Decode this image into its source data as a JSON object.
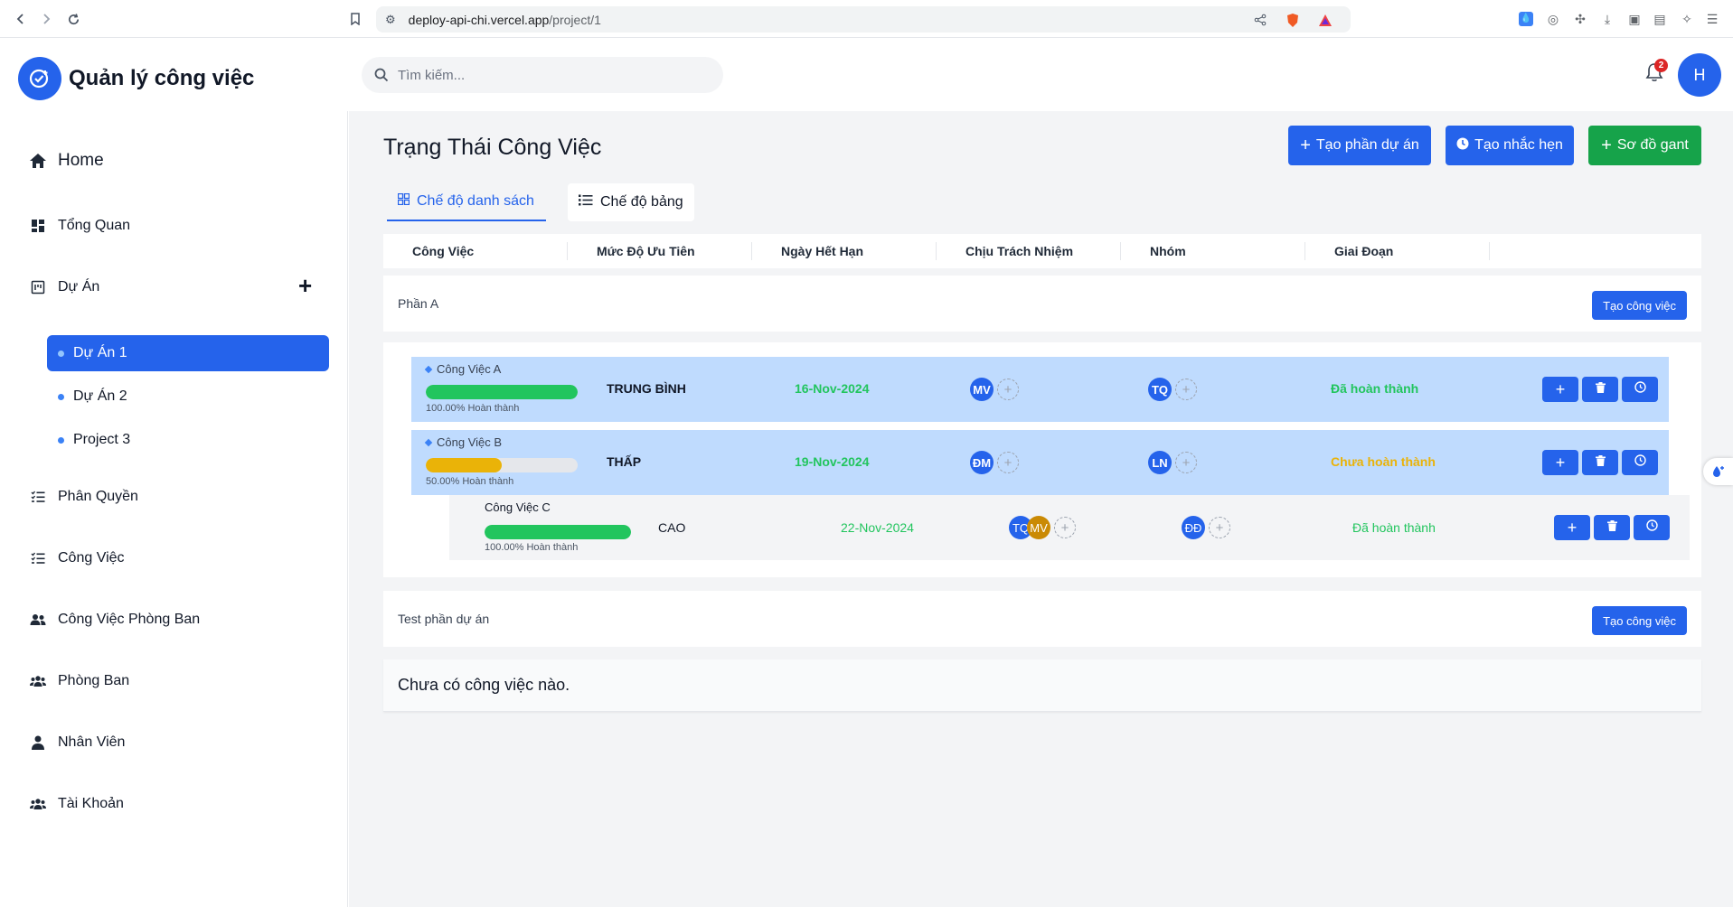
{
  "browser": {
    "url_host": "deploy-api-chi.vercel.app",
    "url_path": "/project/1"
  },
  "header": {
    "app_title": "Quản lý công việc",
    "search_placeholder": "Tìm kiếm...",
    "notification_count": "2",
    "user_initial": "H"
  },
  "sidebar": {
    "home": "Home",
    "items": [
      {
        "label": "Tổng Quan",
        "icon": "dashboard-icon"
      },
      {
        "label": "Dự Án",
        "icon": "project-icon"
      },
      {
        "label": "Phân Quyền",
        "icon": "checklist-icon"
      },
      {
        "label": "Công Việc",
        "icon": "checklist-icon"
      },
      {
        "label": "Công Việc Phòng Ban",
        "icon": "users-icon"
      },
      {
        "label": "Phòng Ban",
        "icon": "users-group-icon"
      },
      {
        "label": "Nhân Viên",
        "icon": "user-icon"
      },
      {
        "label": "Tài Khoản",
        "icon": "users-group-icon"
      }
    ],
    "projects": [
      {
        "label": "Dự Án 1",
        "active": true
      },
      {
        "label": "Dự Án 2",
        "active": false
      },
      {
        "label": "Project 3",
        "active": false
      }
    ]
  },
  "main": {
    "title": "Trạng Thái Công Việc",
    "buttons": {
      "create_section": "Tạo phần dự án",
      "create_reminder": "Tạo nhắc hẹn",
      "gantt": "Sơ đồ gant"
    },
    "tabs": {
      "list": "Chế độ danh sách",
      "board": "Chế độ bảng"
    },
    "columns": [
      "Công Việc",
      "Mức Độ Ưu Tiên",
      "Ngày Hết Hạn",
      "Chịu Trách Nhiệm",
      "Nhóm",
      "Giai Đoạn",
      ""
    ],
    "sections": [
      {
        "name": "Phần A",
        "create_label": "Tạo công việc",
        "tasks": [
          {
            "name": "Công Việc A",
            "progress": 100,
            "progress_text": "100.00% Hoàn thành",
            "priority": "TRUNG BÌNH",
            "due": "16-Nov-2024",
            "assignees": [
              "MV"
            ],
            "groups": [
              "TQ"
            ],
            "stage": "Đã hoàn thành"
          },
          {
            "name": "Công Việc B",
            "progress": 50,
            "progress_text": "50.00% Hoàn thành",
            "priority": "THẤP",
            "due": "19-Nov-2024",
            "assignees": [
              "ĐM"
            ],
            "groups": [
              "LN"
            ],
            "stage": "Chưa hoàn thành"
          },
          {
            "name": "Công Việc C",
            "progress": 100,
            "progress_text": "100.00% Hoàn thành",
            "priority": "CAO",
            "due": "22-Nov-2024",
            "assignees": [
              "TQ",
              "MV"
            ],
            "groups": [
              "ĐĐ"
            ],
            "stage": "Đã hoàn thành"
          }
        ]
      },
      {
        "name": "Test phần dự án",
        "create_label": "Tạo công việc",
        "empty_text": "Chưa có công việc nào."
      }
    ]
  },
  "colors": {
    "primary": "#2563eb",
    "success": "#16a34a",
    "done_text": "#22c55e",
    "pending_text": "#eab308",
    "parent_row": "#bfdbfe"
  }
}
